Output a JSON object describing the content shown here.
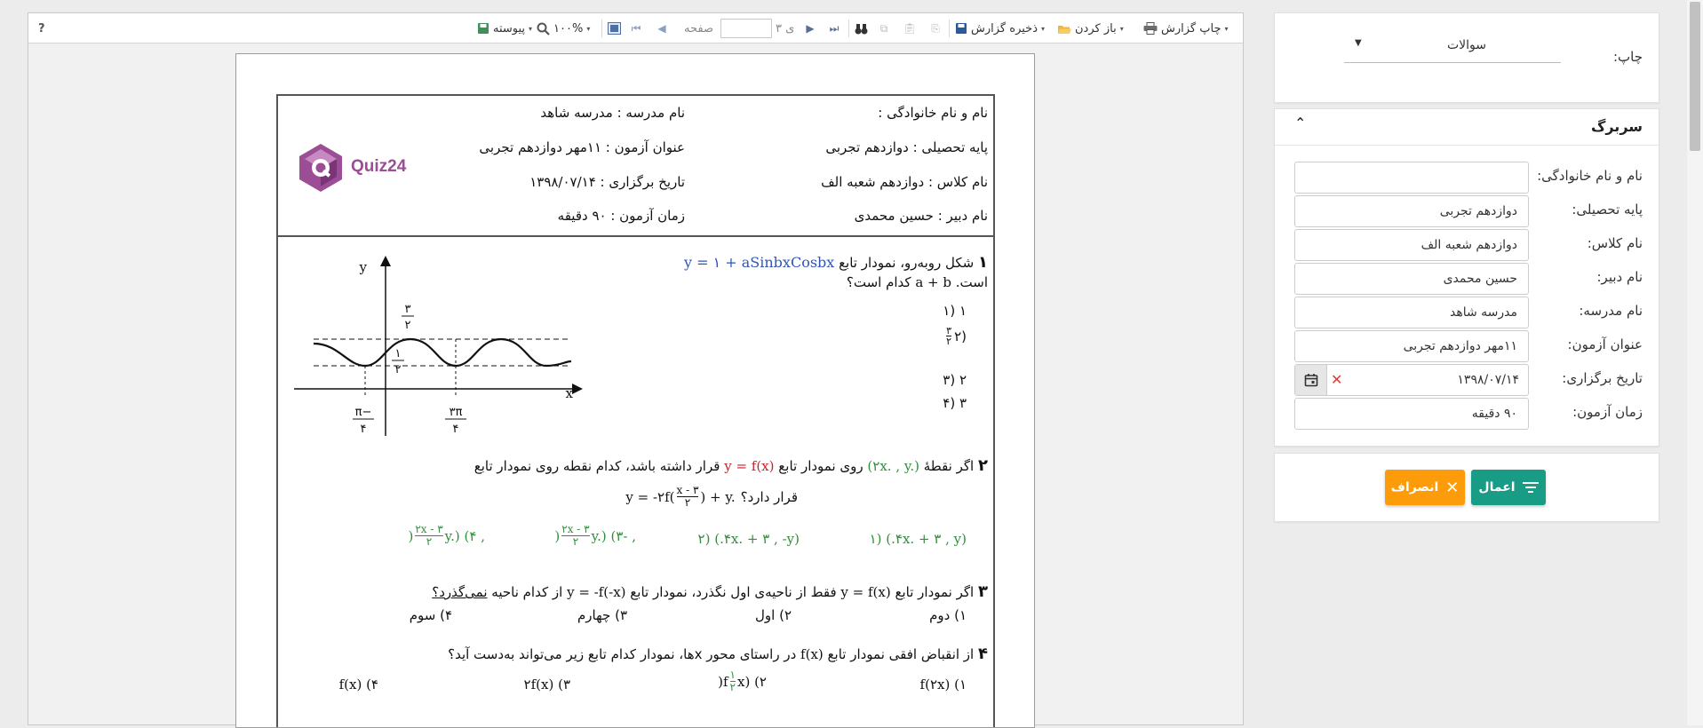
{
  "toolbar": {
    "help": "?",
    "print_report": "چاپ گزارش",
    "open": "باز کردن",
    "save_report": "ذخیره گزارش",
    "of_label": "ی ۳",
    "page_label": "صفحه",
    "zoom": "۱۰۰%",
    "continuous": "پیوسته"
  },
  "report": {
    "header": {
      "fullname": "نام و نام خانوادگی :",
      "school": "نام مدرسه : مدرسه شاهد",
      "grade": "پایه تحصیلی : دوازدهم تجربی",
      "exam_title": "عنوان آزمون : ۱۱مهر دوازدهم تجربی",
      "class": "نام کلاس : دوازدهم شعبه الف",
      "date": "تاریخ برگزاری : ۱۳۹۸/۰۷/۱۴",
      "teacher": "نام دبیر : حسین محمدی",
      "duration": "زمان آزمون : ۹۰ دقیقه",
      "logo_text": "Quiz24"
    },
    "q1": {
      "num": "۱",
      "text_a": "شکل روبه‌رو، نمودار تابع",
      "formula": "y = ۱ + aSinbxCosbx",
      "text_b": "است.",
      "text_c": "کدام است؟",
      "sum": "a + b",
      "options": [
        "۱ (۱",
        "(۲",
        "۲ (۳",
        "۳ (۴"
      ],
      "opt2_num": "۳",
      "opt2_den": "۲",
      "graph": {
        "y_label": "y",
        "x_label": "x",
        "top_num": "۳",
        "top_den": "۲",
        "mid_num": "۱",
        "mid_den": "۲",
        "neg_num": "−π",
        "neg_den": "۴",
        "pos_num": "۳π",
        "pos_den": "۴"
      }
    },
    "q2": {
      "num": "۲",
      "text_a": "اگر نقطهٔ",
      "point": "(۲x. , y.)",
      "text_b": "روی نمودار تابع",
      "fx": "y = f(x)",
      "text_c": "قرار داشته باشد، کدام نقطه روی نمودار تابع",
      "func": "y = -۲f(",
      "func_num": "x - ۳",
      "func_den": "۲",
      "func_end": ") + y.",
      "text_d": "قرار دارد؟",
      "options": [
        "(۴x. + ۳ , y.) (۱",
        "(۴x. + ۳ , -y.) (۲",
        "(",
        ", -y.) (۳",
        "(",
        ", y.) (۴"
      ],
      "opt_num": "۲x - ۳",
      "opt_den": "۲"
    },
    "q3": {
      "num": "۳",
      "text_a": "اگر نمودار تابع",
      "fx": "y = f(x)",
      "text_b": "فقط از ناحیه‌ی اول نگذرد، نمودار تابع",
      "fnx": "y = -f(-x)",
      "text_c": "از کدام ناحیه",
      "text_d": "نمی‌گذرد؟",
      "options": [
        "۱) دوم",
        "۲) اول",
        "۳) چهارم",
        "۴) سوم"
      ]
    },
    "q4": {
      "num": "۴",
      "text_a": "از انقباض افقی نمودار تابع",
      "fx": "f(x)",
      "text_b": "در راستای محور xها، نمودار کدام تابع زیر می‌تواند به‌دست آید؟",
      "options": [
        "f(۲x) (۱",
        "f(",
        "x) (۲",
        "۲f(x) (۳",
        "f(x) (۴"
      ],
      "half_num": "۱",
      "half_den": "۲"
    }
  },
  "panel": {
    "print_label": "چاپ:",
    "print_value": "سوالات",
    "section_title": "سربرگ",
    "fields": [
      {
        "label": "نام و نام خانوادگی:",
        "value": ""
      },
      {
        "label": "پایه تحصیلی:",
        "value": "دوازدهم تجربی"
      },
      {
        "label": "نام کلاس:",
        "value": "دوازدهم شعبه الف"
      },
      {
        "label": "نام دبیر:",
        "value": "حسین محمدی"
      },
      {
        "label": "نام مدرسه:",
        "value": "مدرسه شاهد"
      },
      {
        "label": "عنوان آزمون:",
        "value": "۱۱مهر دوازدهم تجربی"
      },
      {
        "label": "تاریخ برگزاری:",
        "value": "۱۳۹۸/۰۷/۱۴"
      },
      {
        "label": "زمان آزمون:",
        "value": "۹۰ دقیقه"
      }
    ],
    "apply": "اعمال",
    "cancel": "انصراف"
  },
  "colors": {
    "apply": "#199c86",
    "cancel": "#fd9c0b",
    "clear": "#e53935",
    "logo": "#9b4d96"
  },
  "icons": [
    "help-icon",
    "printer-icon",
    "folder-open-icon",
    "save-icon",
    "binoculars-icon",
    "copy-icon",
    "paste-icon",
    "export-icon",
    "first-page-icon",
    "prev-page-icon",
    "next-page-icon",
    "last-page-icon",
    "fit-page-icon",
    "zoom-icon",
    "calendar-icon",
    "clear-icon",
    "filter-icon",
    "close-icon",
    "chevron-up-icon",
    "dropdown-arrow-icon"
  ]
}
